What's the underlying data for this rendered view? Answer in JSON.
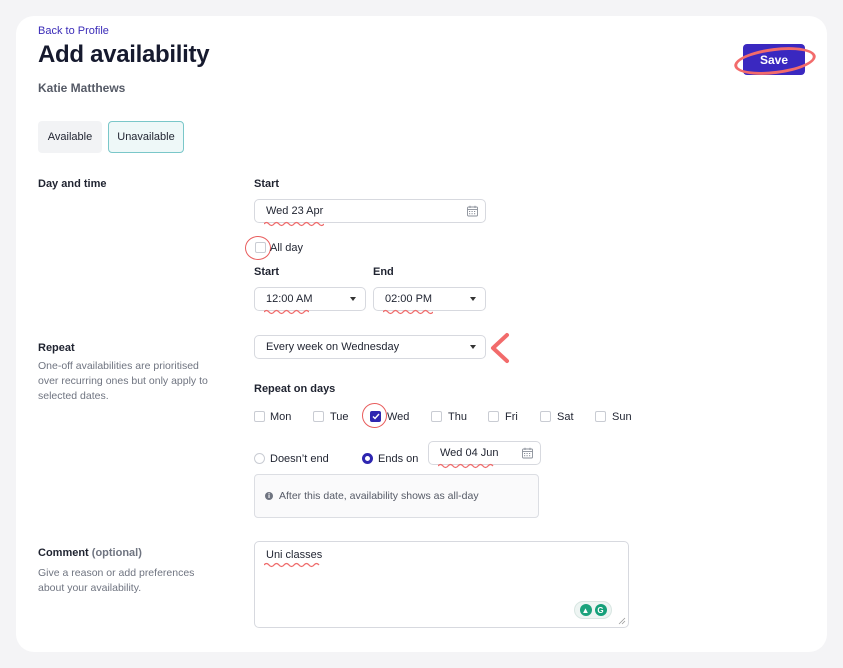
{
  "header": {
    "back_link": "Back to Profile",
    "title": "Add availability",
    "subtitle": "Katie Matthews",
    "save_label": "Save"
  },
  "availability_toggle": {
    "options": [
      "Available",
      "Unavailable"
    ],
    "selected": "Unavailable"
  },
  "day_and_time": {
    "section_label": "Day and time",
    "start_label": "Start",
    "start_date": "Wed 23 Apr",
    "all_day_label": "All day",
    "all_day_checked": false,
    "time_start_label": "Start",
    "time_start_value": "12:00 AM",
    "time_end_label": "End",
    "time_end_value": "02:00 PM"
  },
  "repeat": {
    "section_label": "Repeat",
    "helper": "One-off availabilities are prioritised over recurring ones but only apply to selected dates.",
    "value": "Every week on Wednesday",
    "repeat_on_days_label": "Repeat on days",
    "days": [
      {
        "label": "Mon",
        "checked": false
      },
      {
        "label": "Tue",
        "checked": false
      },
      {
        "label": "Wed",
        "checked": true
      },
      {
        "label": "Thu",
        "checked": false
      },
      {
        "label": "Fri",
        "checked": false
      },
      {
        "label": "Sat",
        "checked": false
      },
      {
        "label": "Sun",
        "checked": false
      }
    ],
    "end_options": {
      "doesnt_end_label": "Doesn’t end",
      "ends_on_label": "Ends on",
      "selected": "Ends on",
      "ends_on_date": "Wed 04 Jun"
    },
    "info_text": "After this date, availability shows as all-day"
  },
  "comment": {
    "section_label": "Comment",
    "optional_label": "(optional)",
    "helper": "Give a reason or add preferences about your availability.",
    "value": "Uni classes"
  },
  "colors": {
    "primary": "#3a28c0",
    "accent_teal": "#7ac7c9",
    "annotation_red": "#f26b6b",
    "grammarly_green": "#15a07a"
  },
  "icons": {
    "date_field": "calendar-icon",
    "select": "chevron-down-icon",
    "info": "info-icon",
    "grammarly": "grammarly-icon"
  }
}
